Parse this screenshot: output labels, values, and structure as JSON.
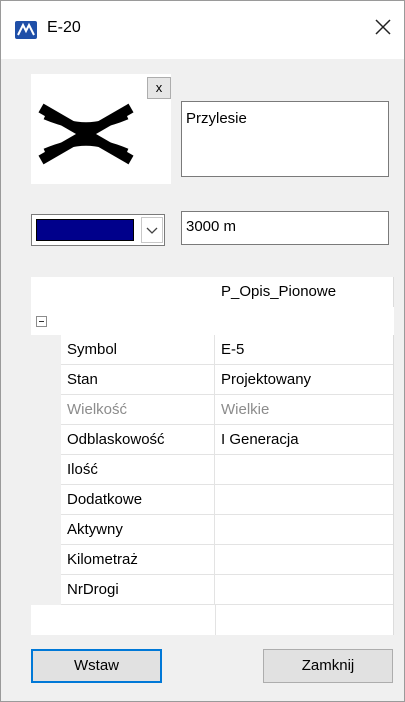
{
  "window": {
    "title": "E-20",
    "icon": "app-logo-icon",
    "close_icon": "close-icon"
  },
  "preview": {
    "symbol_icon": "sign-symbol-icon",
    "clear_label": "x"
  },
  "description": {
    "value": "Przylesie"
  },
  "color_select": {
    "value_color": "#00008b",
    "dropdown_icon": "chevron-down-icon"
  },
  "distance": {
    "value": "3000 m"
  },
  "grid": {
    "column_header": "P_Opis_Pionowe",
    "group_toggle_icon": "collapse-minus-icon",
    "rows": [
      {
        "name": "Symbol",
        "value": "E-5",
        "disabled": false
      },
      {
        "name": "Stan",
        "value": "Projektowany",
        "disabled": false
      },
      {
        "name": "Wielkość",
        "value": "Wielkie",
        "disabled": true
      },
      {
        "name": "Odblaskowość",
        "value": "I Generacja",
        "disabled": false
      },
      {
        "name": "Ilość",
        "value": "",
        "disabled": false
      },
      {
        "name": "Dodatkowe",
        "value": "",
        "disabled": false
      },
      {
        "name": "Aktywny",
        "value": "",
        "disabled": false
      },
      {
        "name": "Kilometraż",
        "value": "",
        "disabled": false
      },
      {
        "name": "NrDrogi",
        "value": "",
        "disabled": false
      }
    ]
  },
  "buttons": {
    "insert": "Wstaw",
    "close": "Zamknij"
  }
}
